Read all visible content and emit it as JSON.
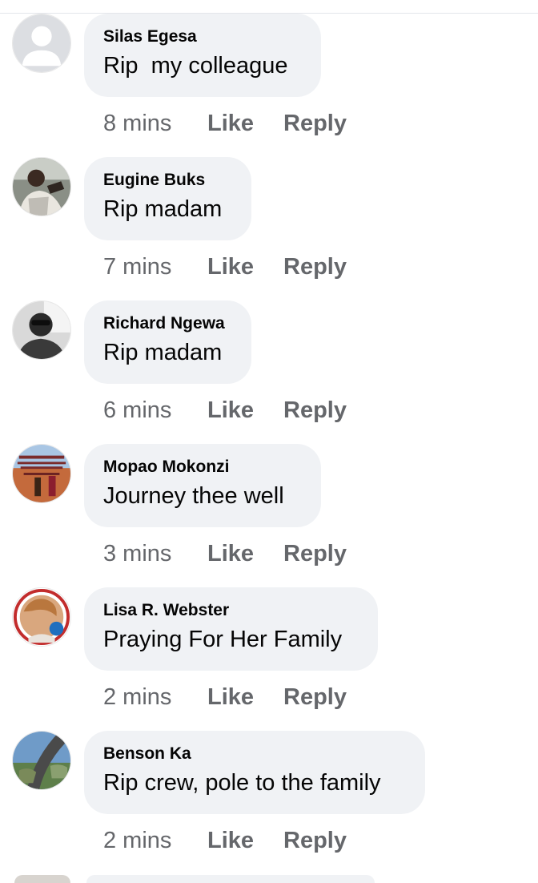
{
  "comments": [
    {
      "author": "Silas Egesa",
      "text": "Rip  my colleague",
      "time": "8 mins",
      "like_label": "Like",
      "reply_label": "Reply",
      "avatar": "default-profile-silhouette"
    },
    {
      "author": "Eugine Buks",
      "text": "Rip madam",
      "time": "7 mins",
      "like_label": "Like",
      "reply_label": "Reply",
      "avatar": "photo-man-outdoors"
    },
    {
      "author": "Richard Ngewa",
      "text": "Rip madam",
      "time": "6 mins",
      "like_label": "Like",
      "reply_label": "Reply",
      "avatar": "photo-man-sunglasses-bw"
    },
    {
      "author": "Mopao Mokonzi",
      "text": "Journey thee well",
      "time": "3 mins",
      "like_label": "Like",
      "reply_label": "Reply",
      "avatar": "photo-quote-poster"
    },
    {
      "author": "Lisa R. Webster",
      "text": "Praying For Her Family",
      "time": "2 mins",
      "like_label": "Like",
      "reply_label": "Reply",
      "avatar": "photo-woman-with-frame"
    },
    {
      "author": "Benson Ka",
      "text": "Rip crew, pole to the family",
      "time": "2 mins",
      "like_label": "Like",
      "reply_label": "Reply",
      "avatar": "photo-highway-aerial"
    }
  ],
  "colors": {
    "bubble_bg": "#f0f2f5",
    "author_text": "#050505",
    "meta_text": "#65676b"
  }
}
